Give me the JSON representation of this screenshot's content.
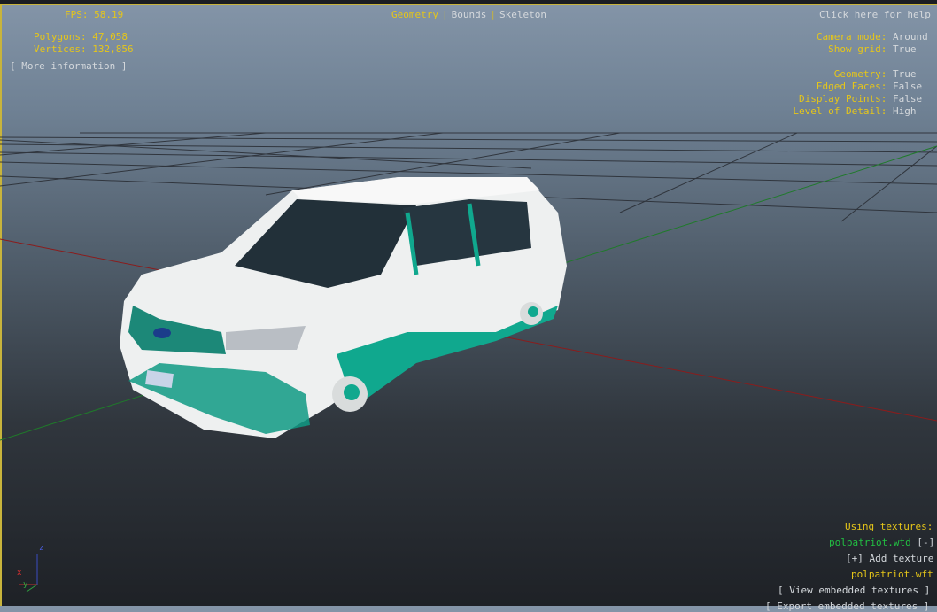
{
  "stats": {
    "fps_label": "FPS:",
    "fps": "58.19",
    "polygons_label": "Polygons:",
    "polygons": "47,058",
    "vertices_label": "Vertices:",
    "vertices": "132,856",
    "more_info": "[ More information ]"
  },
  "modes": {
    "geometry": "Geometry",
    "bounds": "Bounds",
    "skeleton": "Skeleton",
    "active": "Geometry"
  },
  "help": "Click here for help",
  "settings": [
    {
      "label": "Camera mode:",
      "value": "Around"
    },
    {
      "label": "Show grid:",
      "value": "True"
    },
    {
      "label": "Geometry:",
      "value": "True"
    },
    {
      "label": "Edged Faces:",
      "value": "False"
    },
    {
      "label": "Display Points:",
      "value": "False"
    },
    {
      "label": "Level of Detail:",
      "value": "High"
    }
  ],
  "textures": {
    "heading": "Using textures:",
    "wtd": "polpatriot.wtd",
    "remove": "[-]",
    "add": "[+] Add texture",
    "wft": "polpatriot.wft",
    "view_embedded": "[ View embedded textures ]",
    "export_embedded": "[ Export embedded textures ]"
  },
  "axis": {
    "x": "x",
    "y": "y",
    "z": "z"
  },
  "colors": {
    "accent": "#e6c619",
    "text": "#d4d8dc",
    "green": "#22c042",
    "car_teal": "#10a88e"
  }
}
